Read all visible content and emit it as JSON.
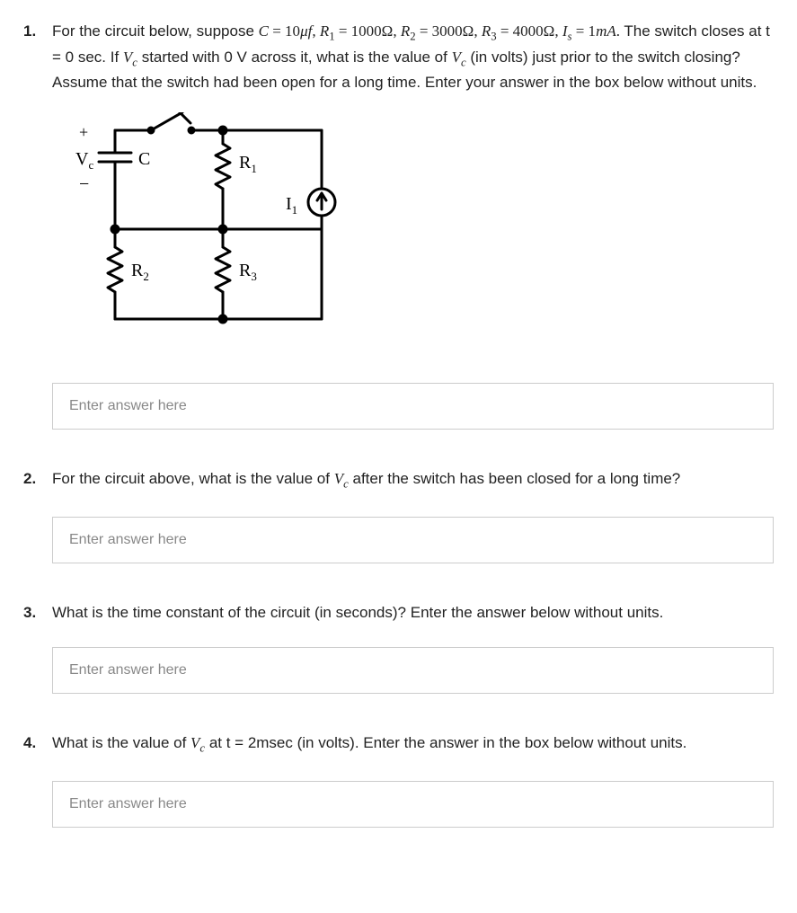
{
  "questions": [
    {
      "number": "1.",
      "text_pre": "For the circuit below, suppose ",
      "params_html": "C = 10μf, R₁ = 1000Ω, R₂ = 3000Ω, R₃ = 4000Ω, Iₛ = 1mA.",
      "text_mid": " The switch closes at t = 0 sec. If ",
      "vc1": "V_c",
      "text_mid2": " started with 0 V across it, what is the value of ",
      "vc2": "V_c",
      "text_post": " (in volts) just prior to the switch closing? Assume that the switch had been open for a long time. Enter your answer in the box below without units.",
      "placeholder": "Enter answer here"
    },
    {
      "number": "2.",
      "text_pre": "For the circuit above, what is the value of ",
      "vc": "V_c",
      "text_post": " after the switch has been closed for a long time?",
      "placeholder": "Enter answer here"
    },
    {
      "number": "3.",
      "text": "What is the time constant of the circuit (in seconds)? Enter the answer below without units.",
      "placeholder": "Enter answer here"
    },
    {
      "number": "4.",
      "text_pre": "What is the value of ",
      "vc": "V_c",
      "text_post": " at t = 2msec (in volts). Enter the answer in the box below without units.",
      "placeholder": "Enter answer here"
    }
  ],
  "circuit": {
    "vc_plus": "+",
    "vc_label": "V",
    "vc_sub": "c",
    "vc_minus": "−",
    "c_label": "C",
    "r1_label": "R",
    "r1_sub": "1",
    "r2_label": "R",
    "r2_sub": "2",
    "r3_label": "R",
    "r3_sub": "3",
    "i1_label": "I",
    "i1_sub": "1"
  }
}
